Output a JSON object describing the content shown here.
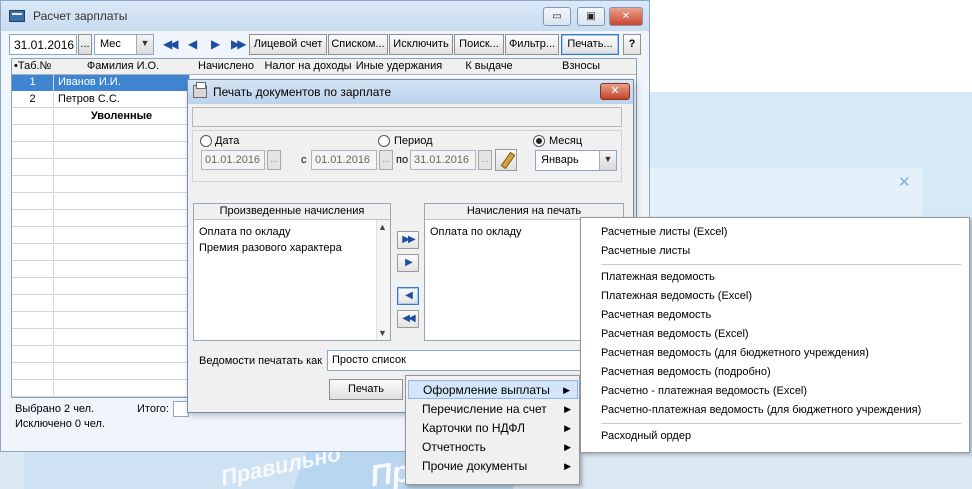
{
  "main": {
    "title": "Расчет зарплаты",
    "buttons": {
      "minimize": "▭",
      "maximize": "▣",
      "close": "✕"
    },
    "date": "31.01.2016",
    "date_btn": "...",
    "period_select": "Мес",
    "nav": {
      "first": "◀◀",
      "prev": "◀",
      "next": "▶",
      "last": "▶▶"
    },
    "toolbar": [
      "Лицевой счет",
      "Списком...",
      "Исключить",
      "Поиск...",
      "Фильтр...",
      "Печать...",
      "?"
    ]
  },
  "grid": {
    "columns": [
      "•Таб.№",
      "Фамилия И.О.",
      "Начислено",
      "Налог на доходы",
      "Иные удержания",
      "К выдаче",
      "Взносы"
    ],
    "rows": [
      {
        "num": "1",
        "name": "Иванов И.И."
      },
      {
        "num": "2",
        "name": "Петров С.С."
      },
      {
        "num": "",
        "name": "Уволенные"
      }
    ]
  },
  "footer": {
    "selected": "Выбрано 2 чел.",
    "excluded": "Исключено 0 чел.",
    "total_label": "Итого:"
  },
  "dialog": {
    "title": "Печать документов по зарплате",
    "close": "✕",
    "radio_date": "Дата",
    "radio_period": "Период",
    "radio_month": "Месяц",
    "date_value": "01.01.2016",
    "from_label": "с",
    "period_from": "01.01.2016",
    "to_label": "по",
    "period_to": "31.01.2016",
    "month_value": "Январь",
    "btn_dots": "...",
    "left_list_title": "Произведенные начисления",
    "left_list": [
      "Оплата по окладу",
      "Премия разового характера"
    ],
    "right_list_title": "Начисления на печать",
    "right_list": [
      "Оплата по окладу"
    ],
    "move": {
      "all_right": "▶▶",
      "right": "▶",
      "left": "◀",
      "all_left": "◀◀"
    },
    "print_as_label": "Ведомости печатать как",
    "print_as_value": "Просто список",
    "print_button": "Печать"
  },
  "context_menu": {
    "items": [
      "Оформление выплаты",
      "Перечисление на счет",
      "Карточки по НДФЛ",
      "Отчетность",
      "Прочие документы"
    ],
    "arrow": "▶"
  },
  "submenu": {
    "group1": [
      "Расчетные листы (Excel)",
      "Расчетные листы"
    ],
    "group2": [
      "Платежная ведомость",
      "Платежная ведомость (Excel)",
      "Расчетная ведомость",
      "Расчетная ведомость (Excel)",
      "Расчетная ведомость (для бюджетного учреждения)",
      "Расчетная ведомость (подробно)",
      "Расчетно - платежная ведомость (Excel)",
      "Расчетно-платежная ведомость (для бюджетного учреждения)"
    ],
    "group3": [
      "Расходный ордер"
    ]
  },
  "background": {
    "close": "✕",
    "watermark1": "Правильно",
    "watermark2": "Просто"
  }
}
